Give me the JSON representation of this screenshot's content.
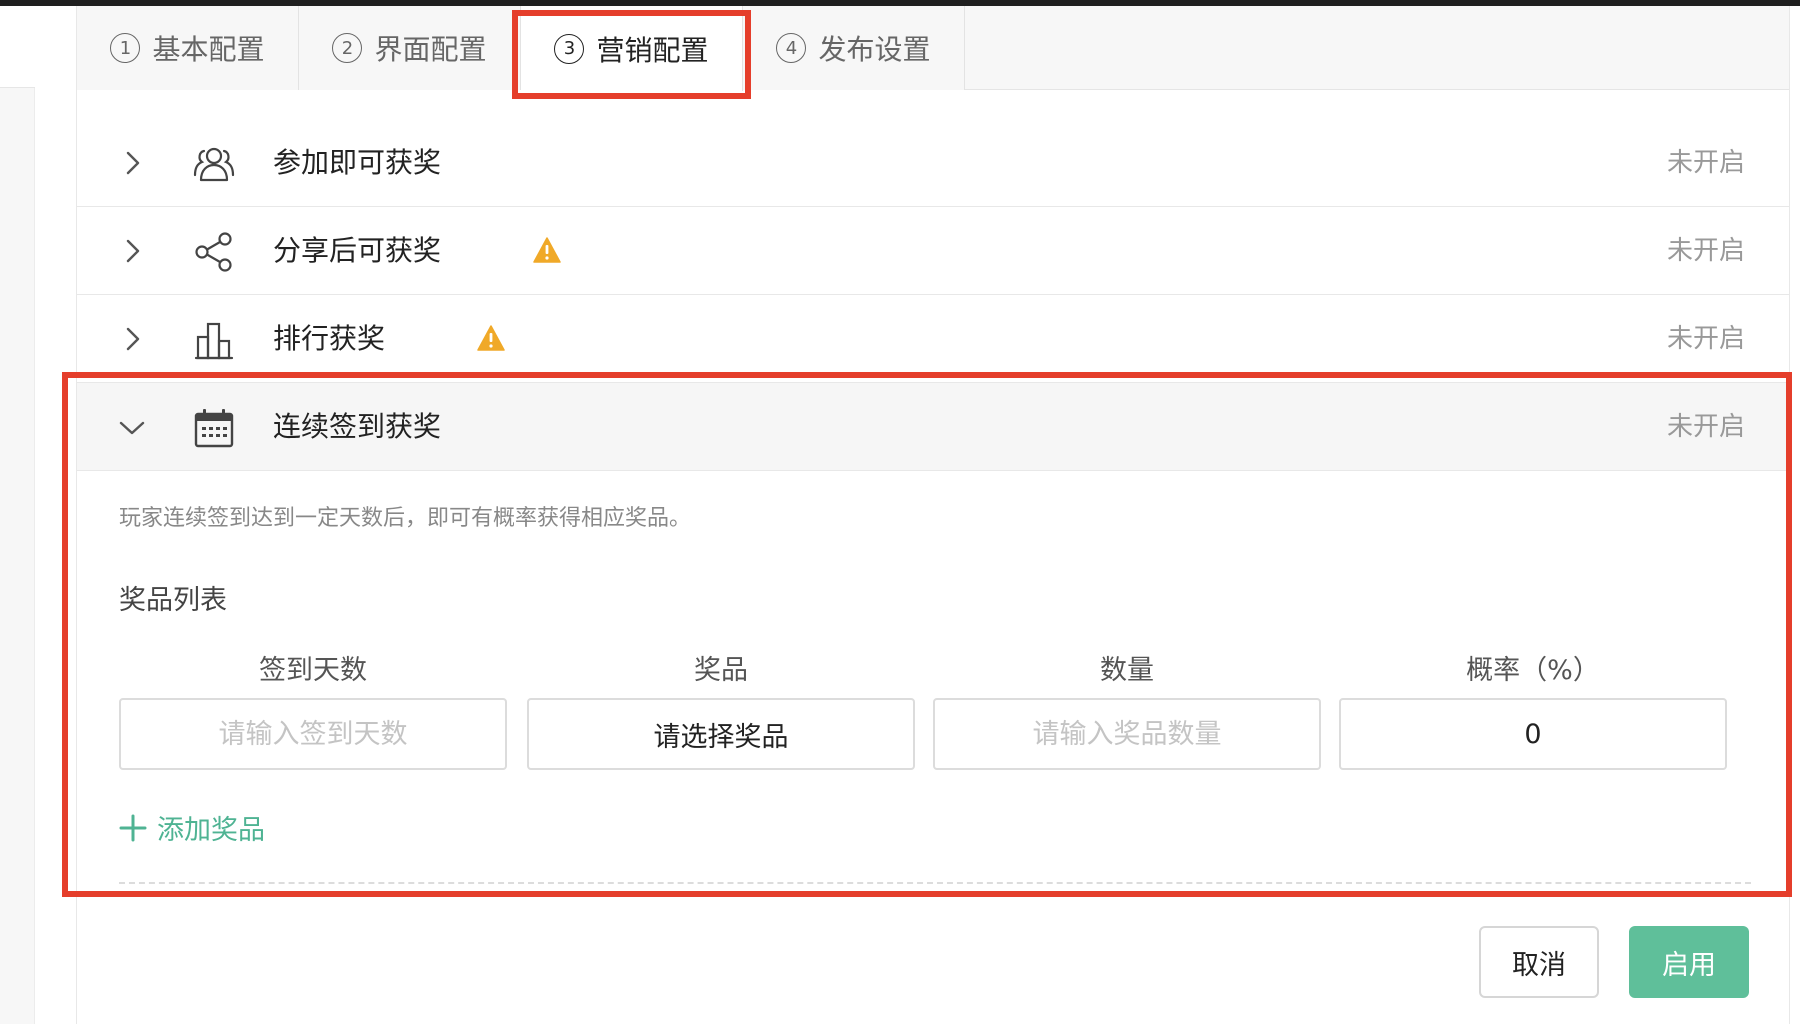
{
  "tabs": [
    {
      "num": "1",
      "label": "基本配置",
      "active": false
    },
    {
      "num": "2",
      "label": "界面配置",
      "active": false
    },
    {
      "num": "3",
      "label": "营销配置",
      "active": true
    },
    {
      "num": "4",
      "label": "发布设置",
      "active": false
    }
  ],
  "rows": [
    {
      "title": "参加即可获奖",
      "icon": "users-icon",
      "warning": false,
      "status": "未开启",
      "expanded": false
    },
    {
      "title": "分享后可获奖",
      "icon": "share-icon",
      "warning": true,
      "status": "未开启",
      "expanded": false
    },
    {
      "title": "排行获奖",
      "icon": "ranking-icon",
      "warning": true,
      "status": "未开启",
      "expanded": false
    },
    {
      "title": "连续签到获奖",
      "icon": "calendar-icon",
      "warning": false,
      "status": "未开启",
      "expanded": true
    }
  ],
  "section": {
    "description": "玩家连续签到达到一定天数后，即可有概率获得相应奖品。",
    "list_title": "奖品列表",
    "columns": [
      "签到天数",
      "奖品",
      "数量",
      "概率（%）"
    ],
    "inputs": {
      "days_placeholder": "请输入签到天数",
      "prize_select": "请选择奖品",
      "quantity_placeholder": "请输入奖品数量",
      "probability_value": "0"
    },
    "add_prize": "添加奖品"
  },
  "footer": {
    "cancel": "取消",
    "enable": "启用"
  },
  "colors": {
    "accent_green": "#5fbf9a",
    "highlight_red": "#e53e2b",
    "warning": "#f0a928"
  }
}
